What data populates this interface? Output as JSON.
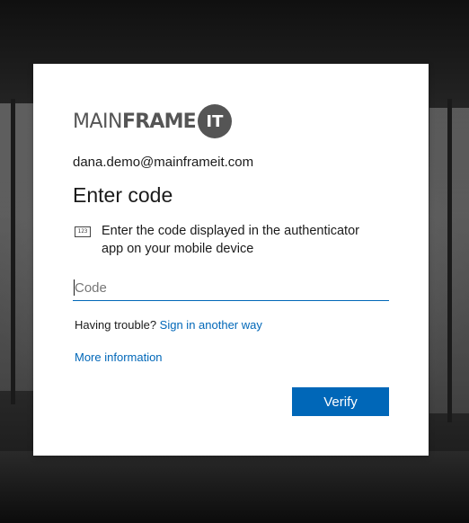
{
  "brand": {
    "logo_light": "MAIN",
    "logo_bold": "FRAME",
    "logo_badge": "IT"
  },
  "identity": "dana.demo@mainframeit.com",
  "title": "Enter code",
  "description": {
    "icon_label": "123",
    "text": "Enter the code displayed in the authenticator app on your mobile device"
  },
  "code_input": {
    "value": "",
    "placeholder": "Code"
  },
  "trouble": {
    "prefix": "Having trouble?",
    "link": "Sign in another way"
  },
  "more_info": "More information",
  "verify_button": "Verify",
  "colors": {
    "accent": "#0067b8",
    "card": "#ffffff",
    "text": "#1b1b1b"
  }
}
